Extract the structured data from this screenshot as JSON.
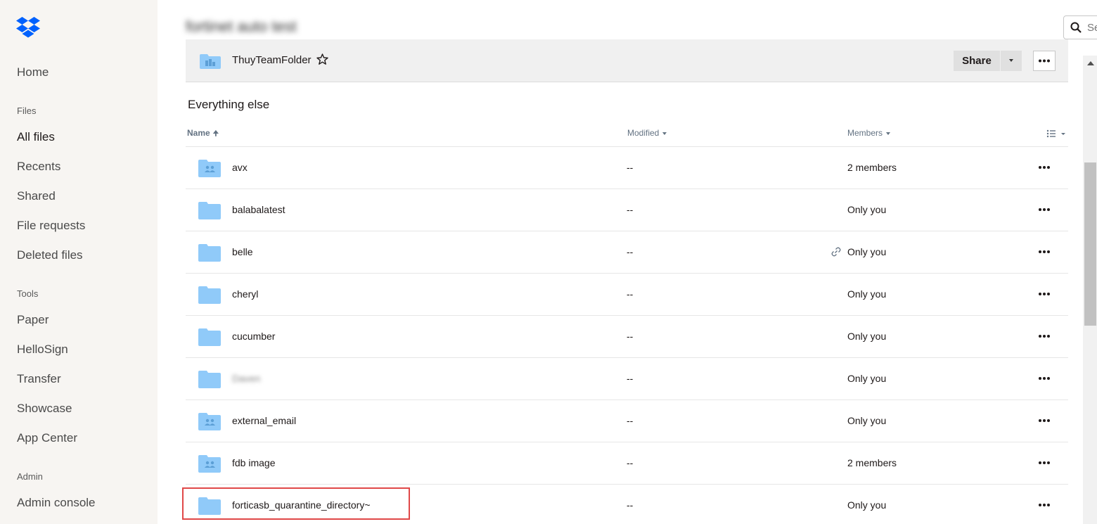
{
  "sidebar": {
    "logo_icon": "dropbox-logo-icon",
    "items_top": [
      {
        "label": "Home"
      }
    ],
    "sections": [
      {
        "title": "Files",
        "items": [
          {
            "label": "All files",
            "active": true
          },
          {
            "label": "Recents"
          },
          {
            "label": "Shared"
          },
          {
            "label": "File requests"
          },
          {
            "label": "Deleted files"
          }
        ]
      },
      {
        "title": "Tools",
        "items": [
          {
            "label": "Paper"
          },
          {
            "label": "HelloSign"
          },
          {
            "label": "Transfer"
          },
          {
            "label": "Showcase"
          },
          {
            "label": "App Center"
          }
        ]
      },
      {
        "title": "Admin",
        "items": [
          {
            "label": "Admin console"
          }
        ]
      }
    ]
  },
  "header": {
    "title": "fortinet auto test",
    "search_placeholder": "Se"
  },
  "team_folder": {
    "name": "ThuyTeamFolder",
    "share_label": "Share"
  },
  "section_heading": "Everything else",
  "columns": {
    "name": "Name",
    "modified": "Modified",
    "members": "Members"
  },
  "rows": [
    {
      "name": "avx",
      "modified": "--",
      "members": "2 members",
      "icon": "shared-folder-icon",
      "shared": true,
      "link": false,
      "blurred": false
    },
    {
      "name": "balabalatest",
      "modified": "--",
      "members": "Only you",
      "icon": "folder-icon",
      "shared": false,
      "link": false,
      "blurred": false
    },
    {
      "name": "belle",
      "modified": "--",
      "members": "Only you",
      "icon": "folder-icon",
      "shared": false,
      "link": true,
      "blurred": false
    },
    {
      "name": "cheryl",
      "modified": "--",
      "members": "Only you",
      "icon": "folder-icon",
      "shared": false,
      "link": false,
      "blurred": false
    },
    {
      "name": "cucumber",
      "modified": "--",
      "members": "Only you",
      "icon": "folder-icon",
      "shared": false,
      "link": false,
      "blurred": false
    },
    {
      "name": "Daven",
      "modified": "--",
      "members": "Only you",
      "icon": "folder-icon",
      "shared": false,
      "link": false,
      "blurred": true
    },
    {
      "name": "external_email",
      "modified": "--",
      "members": "Only you",
      "icon": "shared-folder-icon",
      "shared": true,
      "link": false,
      "blurred": false
    },
    {
      "name": "fdb image",
      "modified": "--",
      "members": "2 members",
      "icon": "shared-folder-icon",
      "shared": true,
      "link": false,
      "blurred": false
    },
    {
      "name": "forticasb_quarantine_directory~",
      "modified": "--",
      "members": "Only you",
      "icon": "folder-icon",
      "shared": false,
      "link": false,
      "blurred": false
    }
  ],
  "colors": {
    "sidebar_bg": "#f7f5f2",
    "folder_blue": "#90caf9",
    "highlight_red": "#e04848"
  }
}
